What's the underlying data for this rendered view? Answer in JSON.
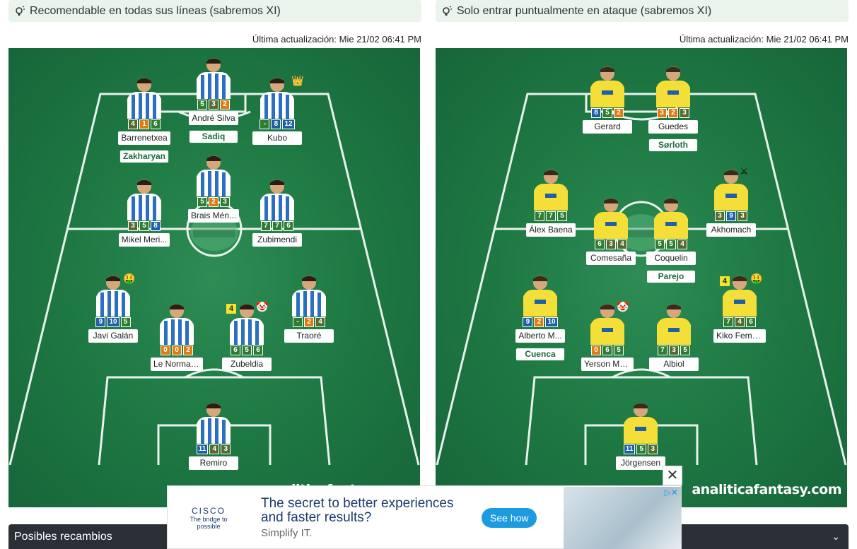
{
  "panels": [
    {
      "title": "Recomendable en todas sus líneas (sabremos XI)",
      "updated": "Última actualización: Mie 21/02 06:41 PM",
      "kit": "realsociedad",
      "players": [
        {
          "name": "André Silva",
          "stats": [
            [
              "5",
              "g"
            ],
            [
              "3",
              "d"
            ],
            [
              "2",
              "o"
            ]
          ],
          "alt": "Sadiq"
        },
        {
          "name": "Barrenetxea",
          "stats": [
            [
              "4",
              "d"
            ],
            [
              "1",
              "o"
            ],
            [
              "6",
              "g"
            ]
          ],
          "alt": "Zakharyan"
        },
        {
          "name": "Kubo",
          "stats": [
            [
              "-",
              "g"
            ],
            [
              "8",
              "b"
            ],
            [
              "12",
              "b"
            ]
          ],
          "alt": ""
        },
        {
          "name": "Brais Mén...",
          "stats": [
            [
              "5",
              "g"
            ],
            [
              "2",
              "o"
            ],
            [
              "3",
              "g"
            ]
          ],
          "alt": ""
        },
        {
          "name": "Mikel Meri...",
          "stats": [
            [
              "3",
              "d"
            ],
            [
              "5",
              "g"
            ],
            [
              "8",
              "b"
            ]
          ],
          "alt": ""
        },
        {
          "name": "Zubimendi",
          "stats": [
            [
              "7",
              "g"
            ],
            [
              "7",
              "g"
            ],
            [
              "6",
              "g"
            ]
          ],
          "alt": ""
        },
        {
          "name": "Javi Galán",
          "stats": [
            [
              "9",
              "b"
            ],
            [
              "10",
              "b"
            ],
            [
              "5",
              "g"
            ]
          ],
          "alt": ""
        },
        {
          "name": "Traoré",
          "stats": [
            [
              "-",
              "g"
            ],
            [
              "2",
              "o"
            ],
            [
              "4",
              "d"
            ]
          ],
          "alt": ""
        },
        {
          "name": "Le Normand",
          "stats": [
            [
              "0",
              "o"
            ],
            [
              "0",
              "o"
            ],
            [
              "2",
              "o"
            ]
          ],
          "alt": ""
        },
        {
          "name": "Zubeldia",
          "stats": [
            [
              "6",
              "g"
            ],
            [
              "5",
              "g"
            ],
            [
              "6",
              "g"
            ]
          ],
          "alt": ""
        },
        {
          "name": "Remiro",
          "stats": [
            [
              "11",
              "b"
            ],
            [
              "4",
              "d"
            ],
            [
              "3",
              "d"
            ]
          ],
          "alt": ""
        }
      ],
      "badges": {
        "kubo": "👑",
        "galan": "🤑",
        "zubeldia_num": "4",
        "zubeldia_icon": "🤡"
      }
    },
    {
      "title": "Solo entrar puntualmente en ataque (sabremos XI)",
      "updated": "Última actualización: Mie 21/02 06:41 PM",
      "kit": "villarreal",
      "players": [
        {
          "name": "Gerard",
          "stats": [
            [
              "8",
              "b"
            ],
            [
              "5",
              "g"
            ],
            [
              "2",
              "o"
            ]
          ],
          "alt": ""
        },
        {
          "name": "Guedes",
          "stats": [
            [
              "3",
              "o"
            ],
            [
              "2",
              "o"
            ],
            [
              "3",
              "d"
            ]
          ],
          "alt": "Sørloth"
        },
        {
          "name": "Álex Baena",
          "stats": [
            [
              "7",
              "g"
            ],
            [
              "7",
              "g"
            ],
            [
              "5",
              "g"
            ]
          ],
          "alt": ""
        },
        {
          "name": "Akhomach",
          "stats": [
            [
              "3",
              "d"
            ],
            [
              "9",
              "b"
            ],
            [
              "3",
              "d"
            ]
          ],
          "alt": ""
        },
        {
          "name": "Comesaña",
          "stats": [
            [
              "6",
              "g"
            ],
            [
              "3",
              "d"
            ],
            [
              "4",
              "d"
            ]
          ],
          "alt": ""
        },
        {
          "name": "Coquelin",
          "stats": [
            [
              "5",
              "g"
            ],
            [
              "5",
              "g"
            ],
            [
              "4",
              "d"
            ]
          ],
          "alt": "Parejo"
        },
        {
          "name": "Alberto M...",
          "stats": [
            [
              "9",
              "b"
            ],
            [
              "2",
              "o"
            ],
            [
              "10",
              "b"
            ]
          ],
          "alt": "Cuenca"
        },
        {
          "name": "Kiko Feme...",
          "stats": [
            [
              "7",
              "g"
            ],
            [
              "4",
              "d"
            ],
            [
              "6",
              "g"
            ]
          ],
          "alt": ""
        },
        {
          "name": "Yerson Mo...",
          "stats": [
            [
              "0",
              "o"
            ],
            [
              "6",
              "g"
            ],
            [
              "5",
              "g"
            ]
          ],
          "alt": ""
        },
        {
          "name": "Albiol",
          "stats": [
            [
              "7",
              "g"
            ],
            [
              "3",
              "d"
            ],
            [
              "5",
              "g"
            ]
          ],
          "alt": ""
        },
        {
          "name": "Jörgensen",
          "stats": [
            [
              "11",
              "b"
            ],
            [
              "5",
              "g"
            ],
            [
              "3",
              "d"
            ]
          ],
          "alt": ""
        }
      ],
      "badges": {
        "kiko_num": "4",
        "kiko_icon": "🤑",
        "yerson_icon": "🤡",
        "akhomach_icon": "⚔"
      }
    }
  ],
  "watermark": "analiticafantasy.com",
  "bottom": {
    "label": "Posibles recambios"
  },
  "ad": {
    "brand": "CISCO",
    "tagline": "The bridge to possible",
    "headline": "The secret to better experiences and faster results?",
    "sub": "Simplify IT.",
    "cta": "See how",
    "close": "✕"
  },
  "colors": {
    "field": "#1f7a44",
    "rso_blue": "#2b6fc2",
    "villa_yellow": "#f4de38"
  }
}
